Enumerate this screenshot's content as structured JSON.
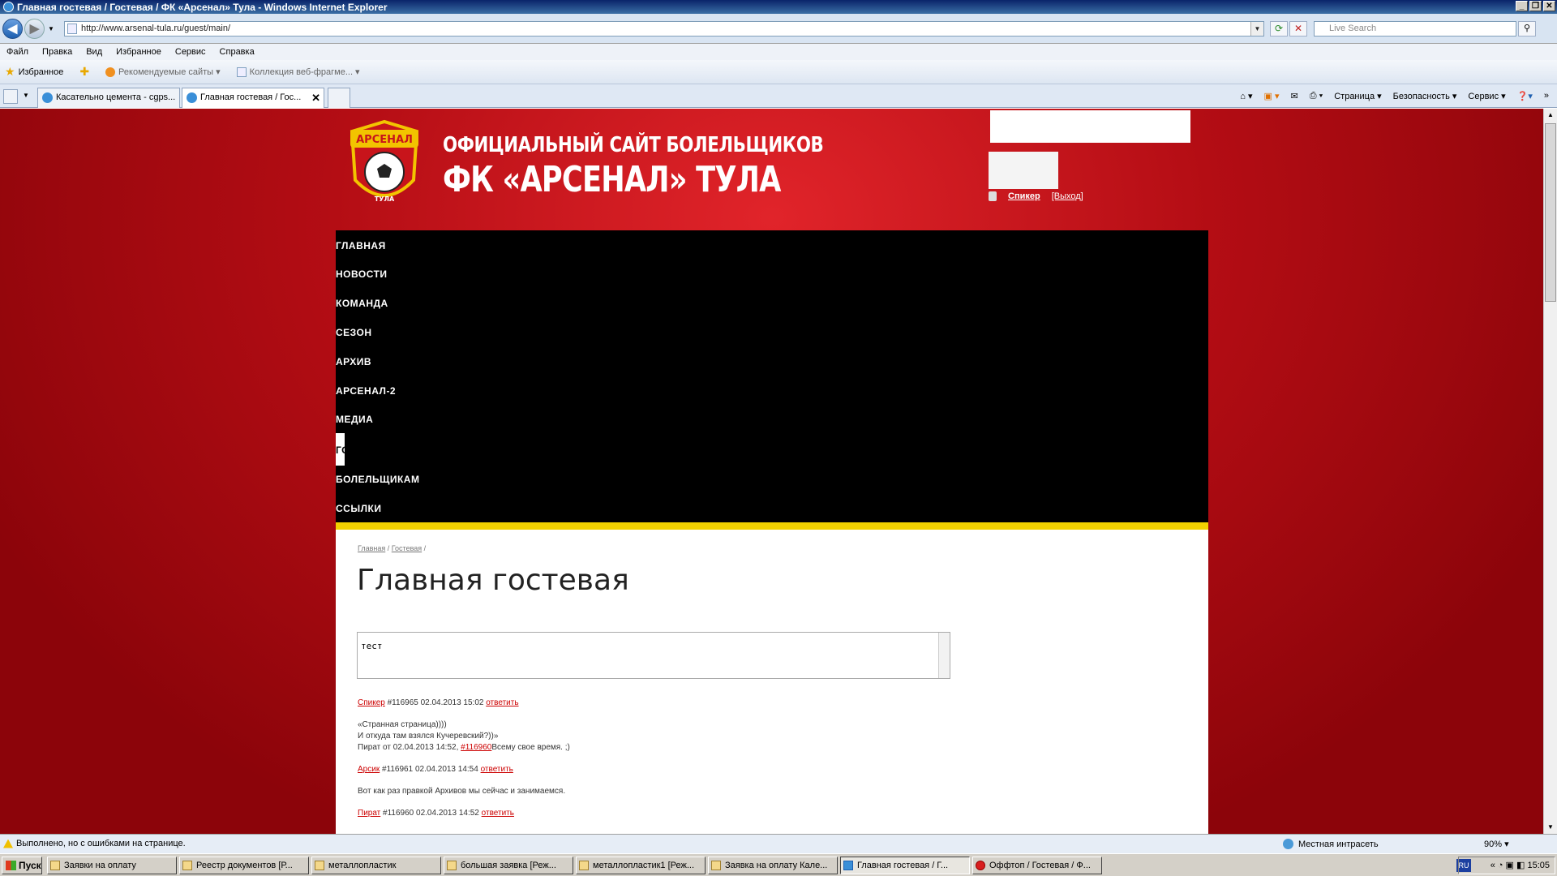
{
  "window": {
    "title": "Главная гостевая / Гостевая / ФК «Арсенал» Тула - Windows Internet Explorer",
    "minimize": "_",
    "restore": "❐",
    "close": "✕"
  },
  "addressbar": {
    "url": "http://www.arsenal-tula.ru/guest/main/",
    "search_placeholder": "Live Search"
  },
  "menubar": [
    "Файл",
    "Правка",
    "Вид",
    "Избранное",
    "Сервис",
    "Справка"
  ],
  "favbar": {
    "favorites": "Избранное",
    "recommended": "Рекомендуемые сайты ▾",
    "gallery": "Коллекция веб-фрагме... ▾"
  },
  "tabs": [
    {
      "label": "Касательно цемента - cgps..."
    },
    {
      "label": "Главная гостевая / Гос..."
    }
  ],
  "commandbar": {
    "page": "Страница ▾",
    "safety": "Безопасность ▾",
    "tools": "Сервис ▾"
  },
  "site": {
    "title_line1": "ОФИЦИАЛЬНЫЙ САЙТ БОЛЕЛЬЩИКОВ",
    "title_line2": "ФК «АРСЕНАЛ» ТУЛА",
    "logo_text_top": "АРСЕНАЛ",
    "logo_text_bottom": "ТУЛА",
    "user": {
      "name": "Спикер",
      "logout": "[Выход]"
    },
    "nav": [
      "ГЛАВНАЯ",
      "НОВОСТИ",
      "КОМАНДА",
      "СЕЗОН",
      "АРХИВ",
      "АРСЕНАЛ-2",
      "МЕДИА",
      "ГОСТЕВАЯ",
      "БОЛЕЛЬЩИКАМ",
      "ССЫЛКИ"
    ]
  },
  "content": {
    "breadcrumb": {
      "home": "Главная",
      "sep": " / ",
      "guest": "Гостевая",
      "tail": " /"
    },
    "heading": "Главная гостевая",
    "editor_text": "тест",
    "posts": [
      {
        "author": "Спикер",
        "meta": " #116965 02.04.2013 15:02 ",
        "reply": "ответить"
      },
      {
        "line": "«Странная страница))))"
      },
      {
        "line": "И откуда там взялся Кучеревский?))»"
      },
      {
        "prefix": "Пират от 02.04.2013 14:52, ",
        "link": "#116960",
        "suffix": "Всему свое время. ;)"
      },
      {
        "author": "Арсик",
        "meta": " #116961 02.04.2013 14:54 ",
        "reply": "ответить"
      },
      {
        "line": "Вот как раз правкой Архивов мы сейчас и занимаемся."
      },
      {
        "author": "Пират",
        "meta": " #116960 02.04.2013 14:52 ",
        "reply": "ответить"
      }
    ]
  },
  "statusbar": {
    "message": "Выполнено, но с ошибками на странице.",
    "zone": "Местная интрасеть",
    "zoom": "90% ▾"
  },
  "taskbar": {
    "start": "Пуск",
    "tasks": [
      "Заявки на оплату",
      "Реестр документов [Р...",
      "металлопластик",
      "большая заявка [Реж...",
      "металлопластик1 [Реж...",
      "Заявка на оплату Кале...",
      "Главная гостевая / Г...",
      "Оффтоп / Гостевая / Ф..."
    ],
    "lang": "RU",
    "clock": "15:05"
  },
  "colors": {
    "accent_red": "#b40d14",
    "nav_black": "#000000",
    "stripe_yellow": "#f2d200"
  }
}
